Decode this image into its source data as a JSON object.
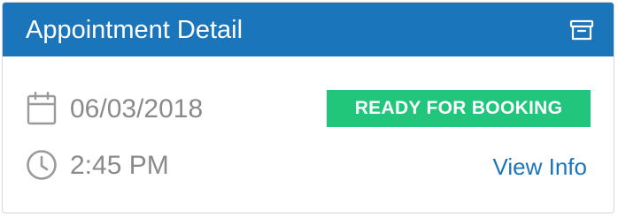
{
  "card": {
    "title": "Appointment Detail",
    "archive_icon": "archive-icon",
    "date": "06/03/2018",
    "date_icon": "calendar-icon",
    "time": "2:45 PM",
    "time_icon": "clock-icon",
    "status": "READY FOR BOOKING",
    "link_label": "View Info"
  },
  "colors": {
    "header": "#1a75ba",
    "status": "#21c67c",
    "muted_text": "#8a8a8a",
    "link": "#1a75ba"
  }
}
